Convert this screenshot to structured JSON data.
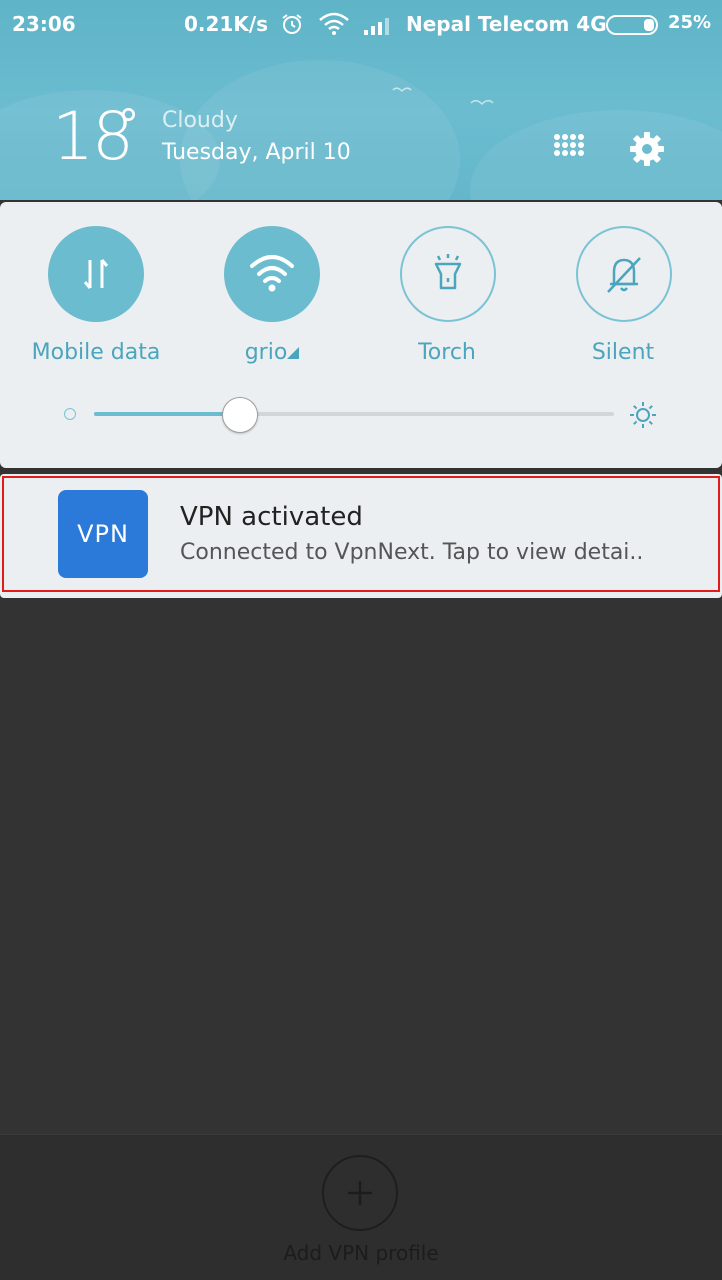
{
  "status_bar": {
    "time": "23:06",
    "net_speed": "0.21K/s",
    "carrier": "Nepal Telecom 4G",
    "battery": "25%",
    "icons": [
      "alarm-icon",
      "wifi-icon",
      "signal-icon",
      "battery-icon"
    ]
  },
  "weather": {
    "temperature": "18",
    "unit": "°",
    "condition": "Cloudy",
    "date": "Tuesday, April 10"
  },
  "header_actions": [
    "grid-icon",
    "gear-icon"
  ],
  "quick_settings": {
    "toggles": [
      {
        "label": "Mobile data",
        "state": "on",
        "icon": "mobile-data-icon"
      },
      {
        "label": "grio",
        "state": "on",
        "icon": "wifi-icon"
      },
      {
        "label": "Torch",
        "state": "off",
        "icon": "torch-icon"
      },
      {
        "label": "Silent",
        "state": "off",
        "icon": "silent-bell-icon"
      }
    ],
    "brightness": 0.28
  },
  "notification": {
    "icon_text": "VPN",
    "title": "VPN activated",
    "body": "Connected to VpnNext. Tap to view detai.."
  },
  "background_app": {
    "add_label": "Add VPN profile"
  },
  "colors": {
    "accent": "#6bbccf",
    "vpn_icon": "#2b7ad9",
    "highlight": "#e21b1b"
  }
}
